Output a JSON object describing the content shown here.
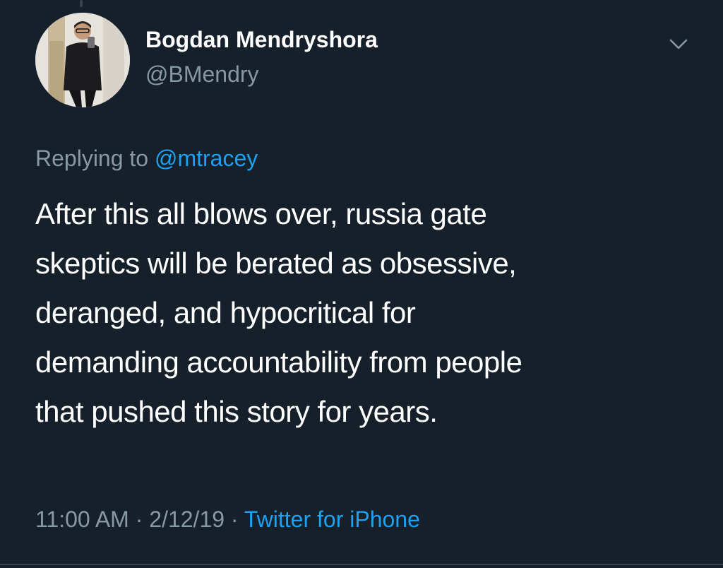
{
  "tweet": {
    "display_name": "Bogdan Mendryshora",
    "handle": "@BMendry",
    "replying_prefix": "Replying to",
    "replying_to": "@mtracey",
    "text_lines": [
      "After this all blows over, russia gate",
      "skeptics will be berated as obsessive,",
      "deranged, and hypocritical for",
      "demanding accountability from people",
      "that pushed this story for years."
    ],
    "time": "11:00 AM",
    "separator": "·",
    "date": "2/12/19",
    "source": "Twitter for iPhone"
  },
  "icons": {
    "menu": "chevron-down-icon",
    "avatar": "avatar"
  },
  "colors": {
    "background": "#15202b",
    "text": "#ffffff",
    "muted": "#8899a6",
    "accent": "#1da1f2"
  }
}
